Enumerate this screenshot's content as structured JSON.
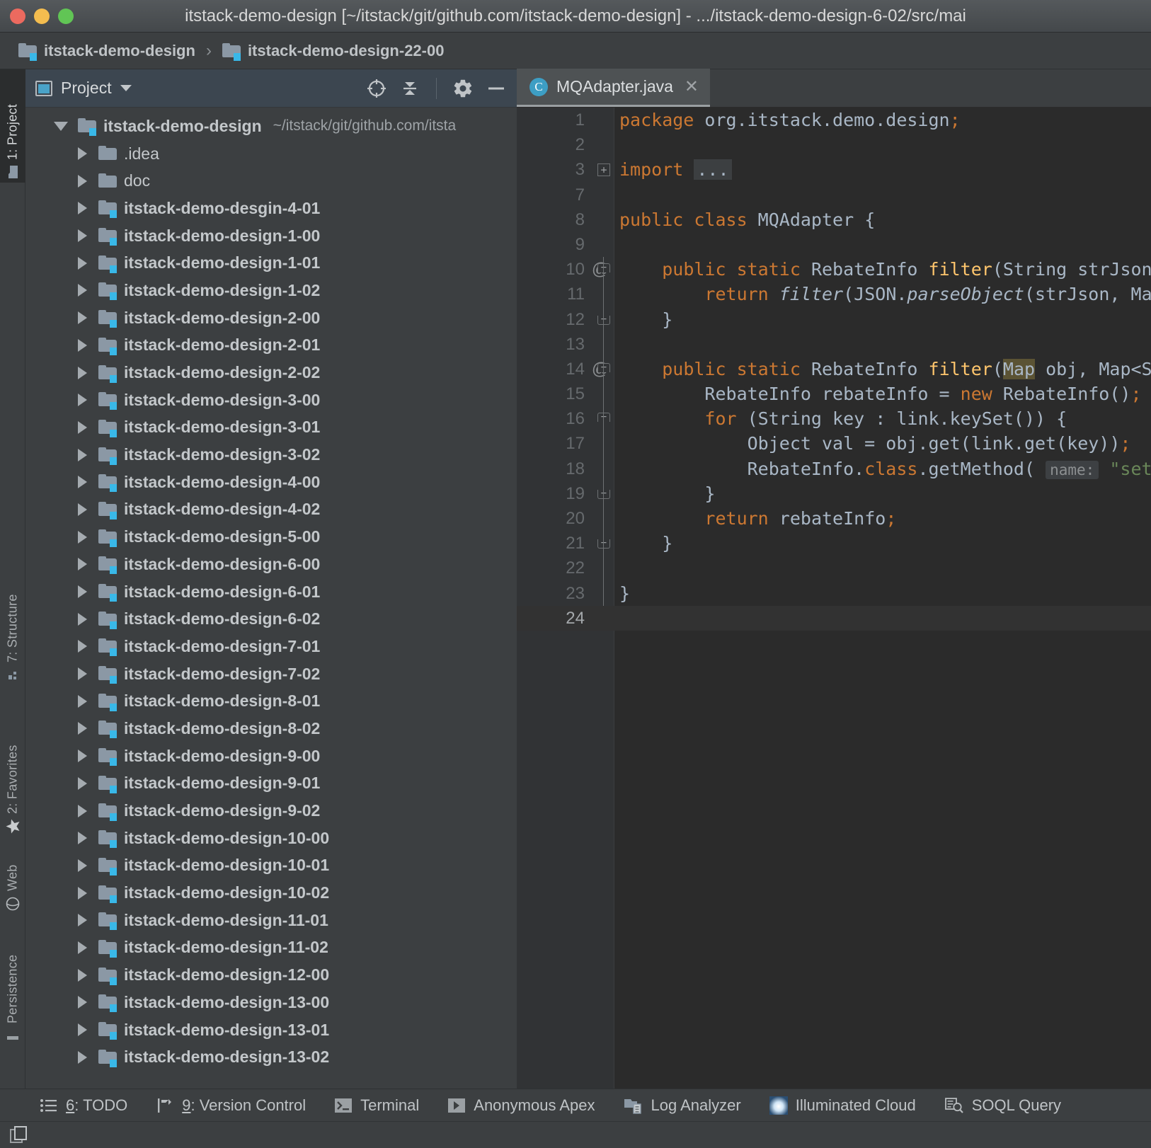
{
  "window": {
    "title": "itstack-demo-design [~/itstack/git/github.com/itstack-demo-design] - .../itstack-demo-design-6-02/src/mai",
    "controls": {
      "close": "close-button",
      "minimize": "minimize-button",
      "maximize": "maximize-button"
    }
  },
  "breadcrumb": {
    "items": [
      {
        "label": "itstack-demo-design",
        "icon": "module-folder-icon"
      },
      {
        "label": "itstack-demo-design-22-00",
        "icon": "module-folder-icon"
      }
    ],
    "separator": "›"
  },
  "left_tool_strip": {
    "tabs": [
      {
        "label": "1: Project",
        "icon": "project-folder-icon",
        "active": true
      },
      {
        "label": "7: Structure",
        "icon": "structure-icon",
        "active": false
      },
      {
        "label": "2: Favorites",
        "icon": "star-icon",
        "active": false
      },
      {
        "label": "Web",
        "icon": "globe-icon",
        "active": false
      },
      {
        "label": "Persistence",
        "icon": "persistence-icon",
        "active": false
      }
    ]
  },
  "project_panel": {
    "toolbar": {
      "title": "Project",
      "view_icon": "project-view-icon",
      "dropdown_icon": "chevron-down-icon",
      "actions": [
        {
          "name": "scroll-from-source-icon",
          "label": "Select Opened File"
        },
        {
          "name": "collapse-all-icon",
          "label": "Collapse All"
        },
        {
          "name": "gear-icon",
          "label": "Settings"
        },
        {
          "name": "hide-icon",
          "label": "Hide"
        }
      ]
    },
    "tree": {
      "root": {
        "label": "itstack-demo-design",
        "path": "~/itstack/git/github.com/itsta",
        "expanded": true,
        "icon": "module-folder-icon"
      },
      "children": [
        {
          "label": ".idea",
          "icon": "folder-icon",
          "module": false
        },
        {
          "label": "doc",
          "icon": "folder-icon",
          "module": false
        },
        {
          "label": "itstack-demo-desgin-4-01",
          "icon": "module-folder-icon",
          "module": true
        },
        {
          "label": "itstack-demo-design-1-00",
          "icon": "module-folder-icon",
          "module": true
        },
        {
          "label": "itstack-demo-design-1-01",
          "icon": "module-folder-icon",
          "module": true
        },
        {
          "label": "itstack-demo-design-1-02",
          "icon": "module-folder-icon",
          "module": true
        },
        {
          "label": "itstack-demo-design-2-00",
          "icon": "module-folder-icon",
          "module": true
        },
        {
          "label": "itstack-demo-design-2-01",
          "icon": "module-folder-icon",
          "module": true
        },
        {
          "label": "itstack-demo-design-2-02",
          "icon": "module-folder-icon",
          "module": true
        },
        {
          "label": "itstack-demo-design-3-00",
          "icon": "module-folder-icon",
          "module": true
        },
        {
          "label": "itstack-demo-design-3-01",
          "icon": "module-folder-icon",
          "module": true
        },
        {
          "label": "itstack-demo-design-3-02",
          "icon": "module-folder-icon",
          "module": true
        },
        {
          "label": "itstack-demo-design-4-00",
          "icon": "module-folder-icon",
          "module": true
        },
        {
          "label": "itstack-demo-design-4-02",
          "icon": "module-folder-icon",
          "module": true
        },
        {
          "label": "itstack-demo-design-5-00",
          "icon": "module-folder-icon",
          "module": true
        },
        {
          "label": "itstack-demo-design-6-00",
          "icon": "module-folder-icon",
          "module": true
        },
        {
          "label": "itstack-demo-design-6-01",
          "icon": "module-folder-icon",
          "module": true
        },
        {
          "label": "itstack-demo-design-6-02",
          "icon": "module-folder-icon",
          "module": true
        },
        {
          "label": "itstack-demo-design-7-01",
          "icon": "module-folder-icon",
          "module": true
        },
        {
          "label": "itstack-demo-design-7-02",
          "icon": "module-folder-icon",
          "module": true
        },
        {
          "label": "itstack-demo-design-8-01",
          "icon": "module-folder-icon",
          "module": true
        },
        {
          "label": "itstack-demo-design-8-02",
          "icon": "module-folder-icon",
          "module": true
        },
        {
          "label": "itstack-demo-design-9-00",
          "icon": "module-folder-icon",
          "module": true
        },
        {
          "label": "itstack-demo-design-9-01",
          "icon": "module-folder-icon",
          "module": true
        },
        {
          "label": "itstack-demo-design-9-02",
          "icon": "module-folder-icon",
          "module": true
        },
        {
          "label": "itstack-demo-design-10-00",
          "icon": "module-folder-icon",
          "module": true
        },
        {
          "label": "itstack-demo-design-10-01",
          "icon": "module-folder-icon",
          "module": true
        },
        {
          "label": "itstack-demo-design-10-02",
          "icon": "module-folder-icon",
          "module": true
        },
        {
          "label": "itstack-demo-design-11-01",
          "icon": "module-folder-icon",
          "module": true
        },
        {
          "label": "itstack-demo-design-11-02",
          "icon": "module-folder-icon",
          "module": true
        },
        {
          "label": "itstack-demo-design-12-00",
          "icon": "module-folder-icon",
          "module": true
        },
        {
          "label": "itstack-demo-design-13-00",
          "icon": "module-folder-icon",
          "module": true
        },
        {
          "label": "itstack-demo-design-13-01",
          "icon": "module-folder-icon",
          "module": true
        },
        {
          "label": "itstack-demo-design-13-02",
          "icon": "module-folder-icon",
          "module": true
        }
      ]
    }
  },
  "editor": {
    "tabs": [
      {
        "label": "MQAdapter.java",
        "icon": "java-class-icon",
        "active": true,
        "close_icon": "close-icon"
      }
    ],
    "current_line": 24,
    "lines": [
      {
        "n": "1",
        "anno": "",
        "text": "package org.itstack.demo.design;"
      },
      {
        "n": "2",
        "anno": "",
        "text": ""
      },
      {
        "n": "3",
        "anno": "",
        "text": "import ..."
      },
      {
        "n": "7",
        "anno": "",
        "text": ""
      },
      {
        "n": "8",
        "anno": "",
        "text": "public class MQAdapter {"
      },
      {
        "n": "9",
        "anno": "",
        "text": ""
      },
      {
        "n": "10",
        "anno": "@",
        "text": "    public static RebateInfo filter(String strJson, Ma"
      },
      {
        "n": "11",
        "anno": "",
        "text": "        return filter(JSON.parseObject(strJson, Map.c"
      },
      {
        "n": "12",
        "anno": "",
        "text": "    }"
      },
      {
        "n": "13",
        "anno": "",
        "text": ""
      },
      {
        "n": "14",
        "anno": "@",
        "text": "    public static RebateInfo filter(Map obj, Map<Strin"
      },
      {
        "n": "15",
        "anno": "",
        "text": "        RebateInfo rebateInfo = new RebateInfo();"
      },
      {
        "n": "16",
        "anno": "",
        "text": "        for (String key : link.keySet()) {"
      },
      {
        "n": "17",
        "anno": "",
        "text": "            Object val = obj.get(link.get(key));"
      },
      {
        "n": "18",
        "anno": "",
        "text": "            RebateInfo.class.getMethod( name: \"set\" + "
      },
      {
        "n": "19",
        "anno": "",
        "text": "        }"
      },
      {
        "n": "20",
        "anno": "",
        "text": "        return rebateInfo;"
      },
      {
        "n": "21",
        "anno": "",
        "text": "    }"
      },
      {
        "n": "22",
        "anno": "",
        "text": ""
      },
      {
        "n": "23",
        "anno": "",
        "text": "}"
      },
      {
        "n": "24",
        "anno": "",
        "text": ""
      }
    ],
    "inlay_hints": [
      {
        "line": 18,
        "label": "name:"
      }
    ],
    "selection": {
      "line": 14,
      "text": "Map"
    }
  },
  "bottom_bar": {
    "buttons": [
      {
        "label": "6: TODO",
        "shortcut": "6",
        "icon": "todo-list-icon"
      },
      {
        "label": "9: Version Control",
        "shortcut": "9",
        "icon": "version-control-icon"
      },
      {
        "label": "Terminal",
        "shortcut": "",
        "icon": "terminal-icon"
      },
      {
        "label": "Anonymous Apex",
        "shortcut": "",
        "icon": "apex-run-icon"
      },
      {
        "label": "Log Analyzer",
        "shortcut": "",
        "icon": "log-analyzer-icon"
      },
      {
        "label": "Illuminated Cloud",
        "shortcut": "",
        "icon": "illuminated-cloud-icon"
      },
      {
        "label": "SOQL Query",
        "shortcut": "",
        "icon": "soql-query-icon"
      }
    ]
  },
  "status_bar": {
    "left_icon": "toggle-tool-windows-icon"
  },
  "colors": {
    "titlebar": "#4a4e50",
    "panel_bg": "#3c3f41",
    "toolbar_blue": "#3c4650",
    "editor_bg": "#2b2b2b",
    "gutter_bg": "#313335",
    "accent_blue": "#39b8e8",
    "keyword_orange": "#cc7832",
    "method_yellow": "#ffc66d",
    "string_green": "#6a8759",
    "text_default": "#a9b7c6"
  }
}
